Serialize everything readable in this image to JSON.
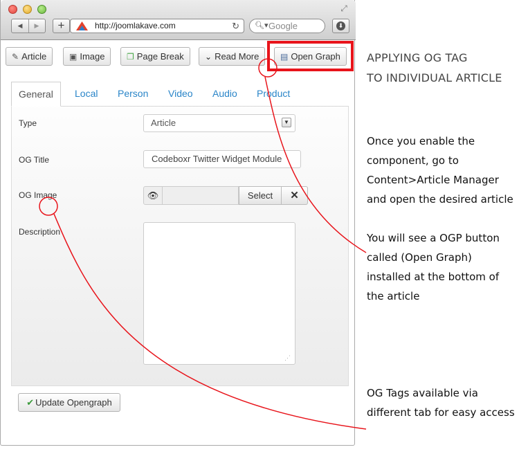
{
  "browser": {
    "url": "http://joomlakave.com",
    "search_placeholder": "Google"
  },
  "toolbar": {
    "buttons": [
      {
        "label": "Article",
        "icon": "edit-icon"
      },
      {
        "label": "Image",
        "icon": "picture-icon"
      },
      {
        "label": "Page Break",
        "icon": "copy-icon"
      },
      {
        "label": "Read More",
        "icon": "chevron-down-icon"
      },
      {
        "label": "Open Graph",
        "icon": "file-icon"
      }
    ]
  },
  "tabs": [
    "General",
    "Local",
    "Person",
    "Video",
    "Audio",
    "Product"
  ],
  "active_tab": "General",
  "form": {
    "type_label": "Type",
    "type_value": "Article",
    "og_title_label": "OG Title",
    "og_title_value": "Codeboxr Twitter Widget Module",
    "og_image_label": "OG Image",
    "select_label": "Select",
    "description_label": "Description",
    "update_label": "Update Opengraph"
  },
  "annotations": {
    "heading_line1": "APPLYING OG TAG",
    "heading_line2": "TO INDIVIDUAL ARTICLE",
    "note1": "Once you enable the component, go to Content>Article Manager and open the desired article",
    "note2": "You will see a OGP button called (Open Graph) installed at the bottom of the article",
    "note3": "OG Tags available via different tab for easy access"
  },
  "colors": {
    "highlight": "#e8141b",
    "tab_link": "#2a85c8",
    "annotation_line": "#e8141b"
  }
}
